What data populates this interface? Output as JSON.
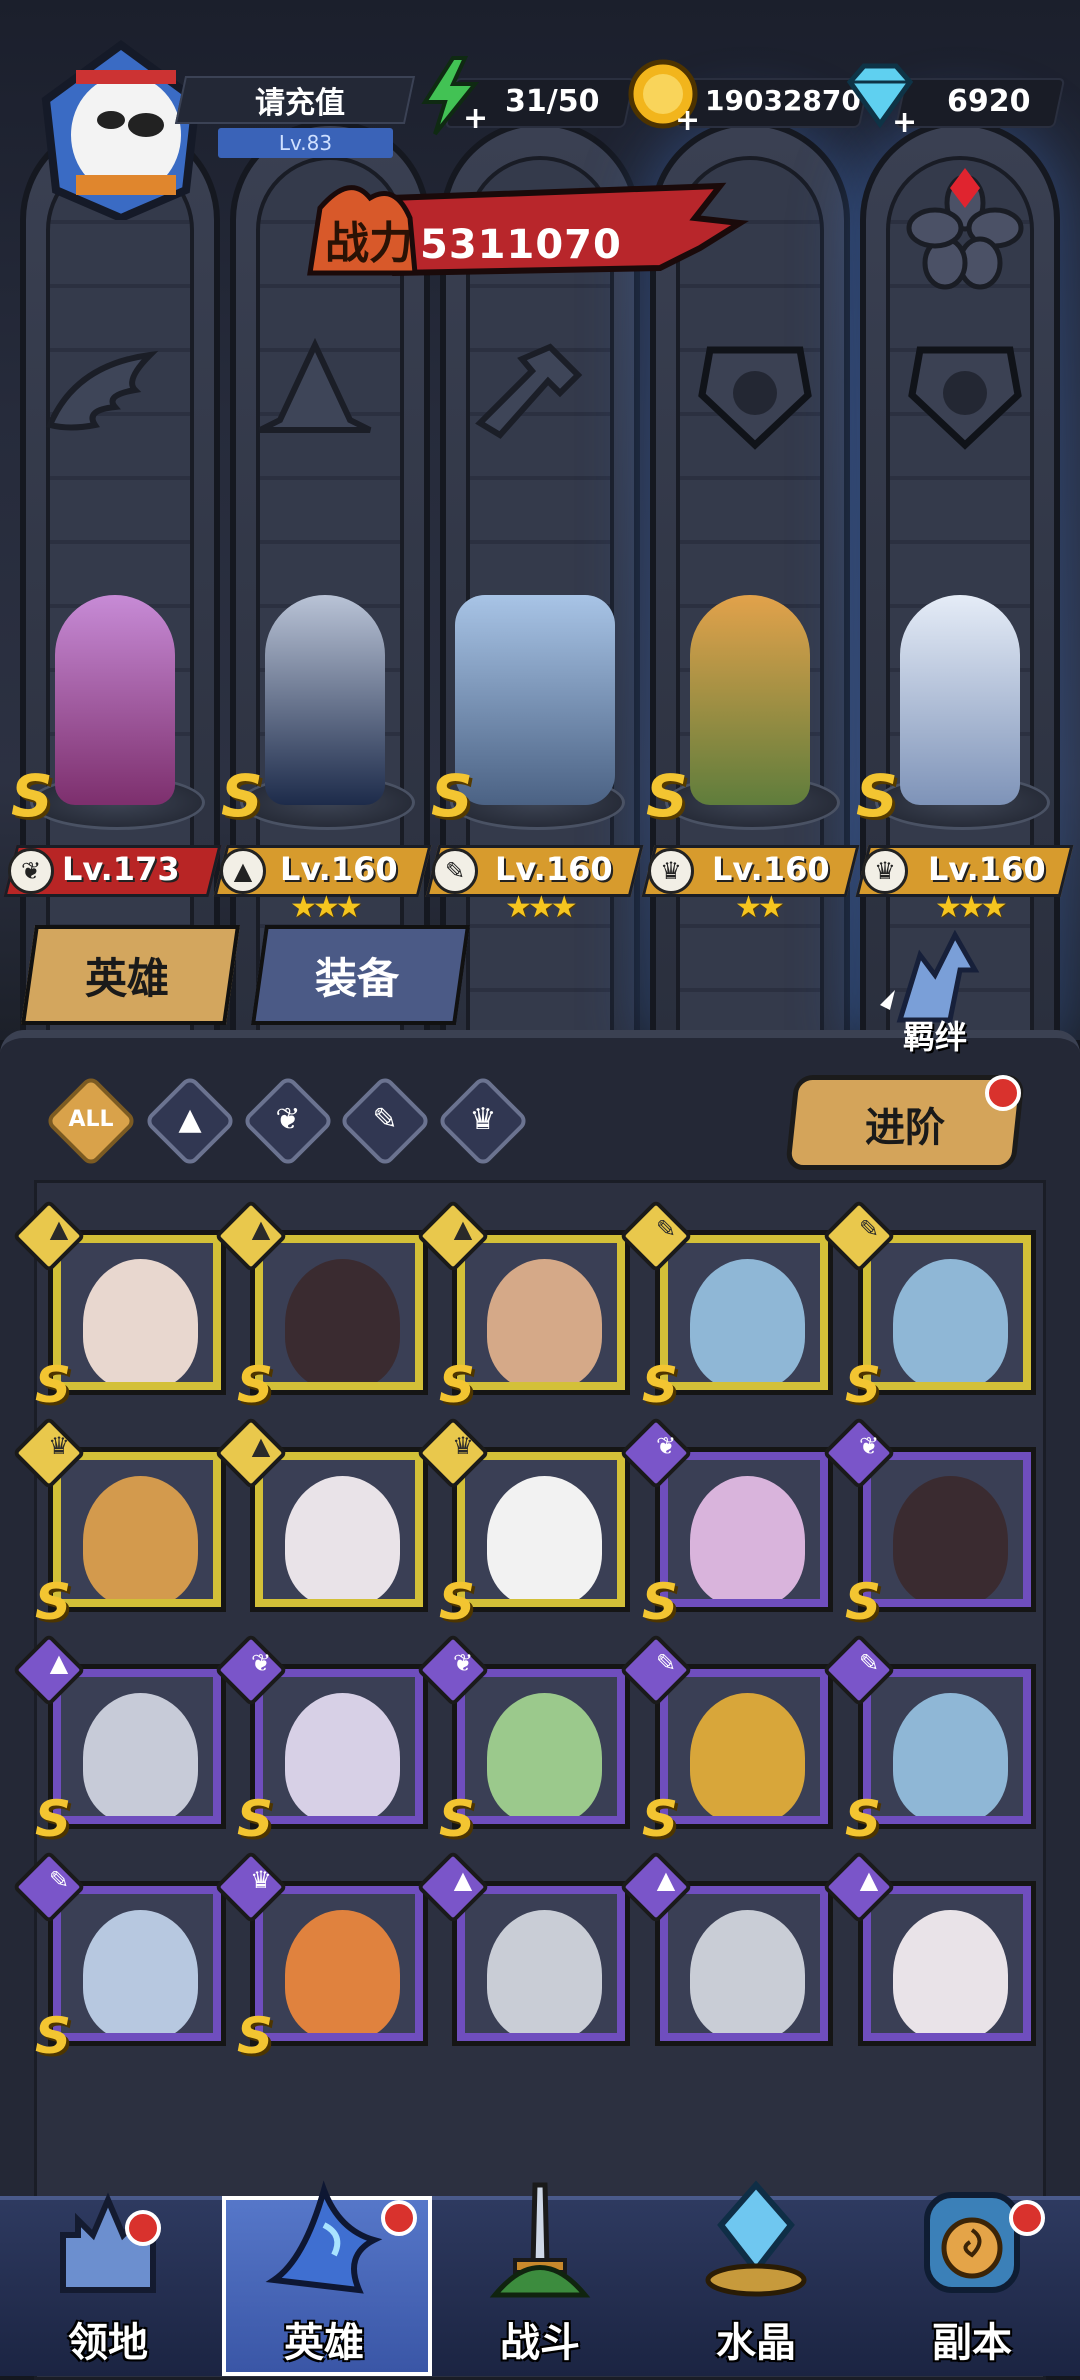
{
  "player": {
    "name": "请充值",
    "level": "Lv.83"
  },
  "resources": {
    "energy": "31/50",
    "gold": "19032870",
    "diamonds": "6920"
  },
  "power": {
    "label": "战力",
    "value": "5311070"
  },
  "lineup": [
    {
      "level": "Lv.173",
      "class_icon": "wing-icon",
      "stars": "",
      "rank": "S"
    },
    {
      "level": "Lv.160",
      "class_icon": "mage-hat-icon",
      "stars": "★★★",
      "rank": "S"
    },
    {
      "level": "Lv.160",
      "class_icon": "wrench-icon",
      "stars": "★★★",
      "rank": "S"
    },
    {
      "level": "Lv.160",
      "class_icon": "beast-icon",
      "stars": "★★",
      "rank": "S"
    },
    {
      "level": "Lv.160",
      "class_icon": "beast-icon",
      "stars": "★★★",
      "rank": "S"
    }
  ],
  "tabs": {
    "heroes": "英雄",
    "equipment": "装备"
  },
  "bond_label": "羁绊",
  "filters": {
    "all": "ALL",
    "icons": [
      "mage-hat-icon",
      "wing-icon",
      "wrench-icon",
      "beast-icon"
    ]
  },
  "advance_label": "进阶",
  "hero_grid": [
    {
      "rank": "S",
      "class_icon": "mage-hat-icon",
      "tier": "gold",
      "face": "#e8d7cf"
    },
    {
      "rank": "S",
      "class_icon": "mage-hat-icon",
      "tier": "gold",
      "face": "#3a2b30"
    },
    {
      "rank": "S",
      "class_icon": "mage-hat-icon",
      "tier": "gold",
      "face": "#d5a988"
    },
    {
      "rank": "S",
      "class_icon": "wrench-icon",
      "tier": "gold",
      "face": "#8fb7d6"
    },
    {
      "rank": "S",
      "class_icon": "wrench-icon",
      "tier": "gold",
      "face": "#8fb7d6"
    },
    {
      "rank": "S",
      "class_icon": "beast-icon",
      "tier": "gold",
      "face": "#d39a4d"
    },
    {
      "rank": "",
      "class_icon": "mage-hat-icon",
      "tier": "gold",
      "face": "#e9e3e8"
    },
    {
      "rank": "S",
      "class_icon": "beast-icon",
      "tier": "gold",
      "face": "#f2f2f2"
    },
    {
      "rank": "S",
      "class_icon": "wing-icon",
      "tier": "purple",
      "face": "#d9b4dc"
    },
    {
      "rank": "S",
      "class_icon": "wing-icon",
      "tier": "purple",
      "face": "#3a2b30"
    },
    {
      "rank": "S",
      "class_icon": "mage-hat-icon",
      "tier": "purple",
      "face": "#c7cbd8"
    },
    {
      "rank": "S",
      "class_icon": "wing-icon",
      "tier": "purple",
      "face": "#d7d0e6"
    },
    {
      "rank": "S",
      "class_icon": "wing-icon",
      "tier": "purple",
      "face": "#9bc98c"
    },
    {
      "rank": "S",
      "class_icon": "wrench-icon",
      "tier": "purple",
      "face": "#d8a63a"
    },
    {
      "rank": "S",
      "class_icon": "wrench-icon",
      "tier": "purple",
      "face": "#8fb7d6"
    },
    {
      "rank": "S",
      "class_icon": "wrench-icon",
      "tier": "purple",
      "face": "#b7c8e0"
    },
    {
      "rank": "S",
      "class_icon": "beast-icon",
      "tier": "purple",
      "face": "#e0823e"
    },
    {
      "rank": "",
      "class_icon": "mage-hat-icon",
      "tier": "purple",
      "face": "#c9cdd6"
    },
    {
      "rank": "",
      "class_icon": "mage-hat-icon",
      "tier": "purple",
      "face": "#c9cdd6"
    },
    {
      "rank": "",
      "class_icon": "mage-hat-icon",
      "tier": "purple",
      "face": "#e9e3e8"
    }
  ],
  "nav": [
    {
      "label": "领地",
      "icon": "castle-icon",
      "badge": true
    },
    {
      "label": "英雄",
      "icon": "wizard-hat-icon",
      "badge": true,
      "active": true
    },
    {
      "label": "战斗",
      "icon": "sword-icon",
      "badge": false
    },
    {
      "label": "水晶",
      "icon": "crystal-icon",
      "badge": false
    },
    {
      "label": "副本",
      "icon": "portal-icon",
      "badge": true
    }
  ],
  "colors": {
    "gold_tier": "#d3c038",
    "purple_tier": "#6f4ebe",
    "accent": "#d4a45a",
    "power_red": "#b8262b"
  }
}
